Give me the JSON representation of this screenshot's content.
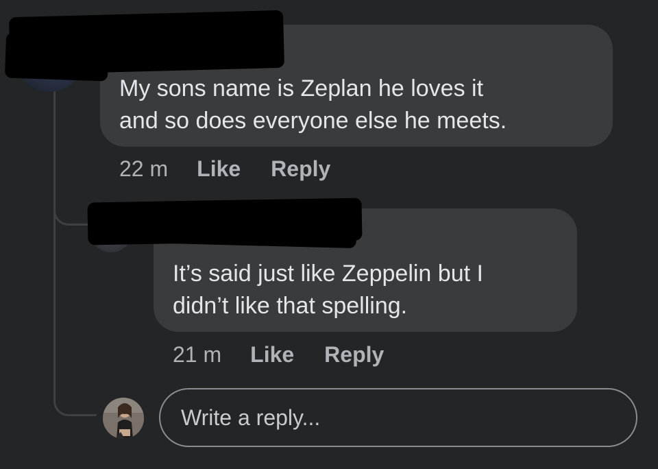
{
  "colors": {
    "background": "#242526",
    "bubble": "#3a3b3c",
    "text": "#e4e6eb",
    "meta_text": "#b0b3b8",
    "thread_line": "#3e4042"
  },
  "comments": [
    {
      "author_redacted": true,
      "text_lines": [
        "My sons name is Zeplan he loves it",
        "and so does everyone else he meets."
      ],
      "time": "22 m",
      "like_label": "Like",
      "reply_label": "Reply"
    },
    {
      "author_redacted": true,
      "text_lines": [
        "It’s said just like Zeppelin but I",
        "didn’t like that spelling."
      ],
      "time": "21 m",
      "like_label": "Like",
      "reply_label": "Reply"
    }
  ],
  "reply_input": {
    "placeholder": "Write a reply...",
    "value": ""
  }
}
